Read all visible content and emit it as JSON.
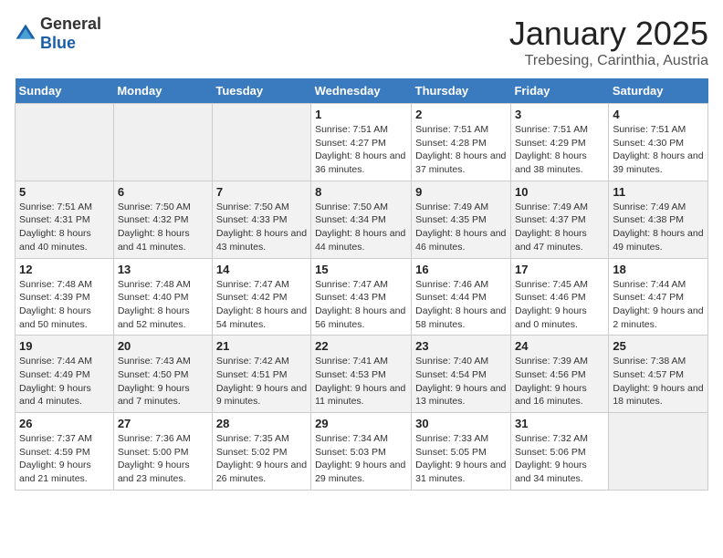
{
  "logo": {
    "general": "General",
    "blue": "Blue"
  },
  "title": "January 2025",
  "location": "Trebesing, Carinthia, Austria",
  "weekdays": [
    "Sunday",
    "Monday",
    "Tuesday",
    "Wednesday",
    "Thursday",
    "Friday",
    "Saturday"
  ],
  "weeks": [
    [
      {
        "day": "",
        "content": ""
      },
      {
        "day": "",
        "content": ""
      },
      {
        "day": "",
        "content": ""
      },
      {
        "day": "1",
        "content": "Sunrise: 7:51 AM\nSunset: 4:27 PM\nDaylight: 8 hours and 36 minutes."
      },
      {
        "day": "2",
        "content": "Sunrise: 7:51 AM\nSunset: 4:28 PM\nDaylight: 8 hours and 37 minutes."
      },
      {
        "day": "3",
        "content": "Sunrise: 7:51 AM\nSunset: 4:29 PM\nDaylight: 8 hours and 38 minutes."
      },
      {
        "day": "4",
        "content": "Sunrise: 7:51 AM\nSunset: 4:30 PM\nDaylight: 8 hours and 39 minutes."
      }
    ],
    [
      {
        "day": "5",
        "content": "Sunrise: 7:51 AM\nSunset: 4:31 PM\nDaylight: 8 hours and 40 minutes."
      },
      {
        "day": "6",
        "content": "Sunrise: 7:50 AM\nSunset: 4:32 PM\nDaylight: 8 hours and 41 minutes."
      },
      {
        "day": "7",
        "content": "Sunrise: 7:50 AM\nSunset: 4:33 PM\nDaylight: 8 hours and 43 minutes."
      },
      {
        "day": "8",
        "content": "Sunrise: 7:50 AM\nSunset: 4:34 PM\nDaylight: 8 hours and 44 minutes."
      },
      {
        "day": "9",
        "content": "Sunrise: 7:49 AM\nSunset: 4:35 PM\nDaylight: 8 hours and 46 minutes."
      },
      {
        "day": "10",
        "content": "Sunrise: 7:49 AM\nSunset: 4:37 PM\nDaylight: 8 hours and 47 minutes."
      },
      {
        "day": "11",
        "content": "Sunrise: 7:49 AM\nSunset: 4:38 PM\nDaylight: 8 hours and 49 minutes."
      }
    ],
    [
      {
        "day": "12",
        "content": "Sunrise: 7:48 AM\nSunset: 4:39 PM\nDaylight: 8 hours and 50 minutes."
      },
      {
        "day": "13",
        "content": "Sunrise: 7:48 AM\nSunset: 4:40 PM\nDaylight: 8 hours and 52 minutes."
      },
      {
        "day": "14",
        "content": "Sunrise: 7:47 AM\nSunset: 4:42 PM\nDaylight: 8 hours and 54 minutes."
      },
      {
        "day": "15",
        "content": "Sunrise: 7:47 AM\nSunset: 4:43 PM\nDaylight: 8 hours and 56 minutes."
      },
      {
        "day": "16",
        "content": "Sunrise: 7:46 AM\nSunset: 4:44 PM\nDaylight: 8 hours and 58 minutes."
      },
      {
        "day": "17",
        "content": "Sunrise: 7:45 AM\nSunset: 4:46 PM\nDaylight: 9 hours and 0 minutes."
      },
      {
        "day": "18",
        "content": "Sunrise: 7:44 AM\nSunset: 4:47 PM\nDaylight: 9 hours and 2 minutes."
      }
    ],
    [
      {
        "day": "19",
        "content": "Sunrise: 7:44 AM\nSunset: 4:49 PM\nDaylight: 9 hours and 4 minutes."
      },
      {
        "day": "20",
        "content": "Sunrise: 7:43 AM\nSunset: 4:50 PM\nDaylight: 9 hours and 7 minutes."
      },
      {
        "day": "21",
        "content": "Sunrise: 7:42 AM\nSunset: 4:51 PM\nDaylight: 9 hours and 9 minutes."
      },
      {
        "day": "22",
        "content": "Sunrise: 7:41 AM\nSunset: 4:53 PM\nDaylight: 9 hours and 11 minutes."
      },
      {
        "day": "23",
        "content": "Sunrise: 7:40 AM\nSunset: 4:54 PM\nDaylight: 9 hours and 13 minutes."
      },
      {
        "day": "24",
        "content": "Sunrise: 7:39 AM\nSunset: 4:56 PM\nDaylight: 9 hours and 16 minutes."
      },
      {
        "day": "25",
        "content": "Sunrise: 7:38 AM\nSunset: 4:57 PM\nDaylight: 9 hours and 18 minutes."
      }
    ],
    [
      {
        "day": "26",
        "content": "Sunrise: 7:37 AM\nSunset: 4:59 PM\nDaylight: 9 hours and 21 minutes."
      },
      {
        "day": "27",
        "content": "Sunrise: 7:36 AM\nSunset: 5:00 PM\nDaylight: 9 hours and 23 minutes."
      },
      {
        "day": "28",
        "content": "Sunrise: 7:35 AM\nSunset: 5:02 PM\nDaylight: 9 hours and 26 minutes."
      },
      {
        "day": "29",
        "content": "Sunrise: 7:34 AM\nSunset: 5:03 PM\nDaylight: 9 hours and 29 minutes."
      },
      {
        "day": "30",
        "content": "Sunrise: 7:33 AM\nSunset: 5:05 PM\nDaylight: 9 hours and 31 minutes."
      },
      {
        "day": "31",
        "content": "Sunrise: 7:32 AM\nSunset: 5:06 PM\nDaylight: 9 hours and 34 minutes."
      },
      {
        "day": "",
        "content": ""
      }
    ]
  ]
}
